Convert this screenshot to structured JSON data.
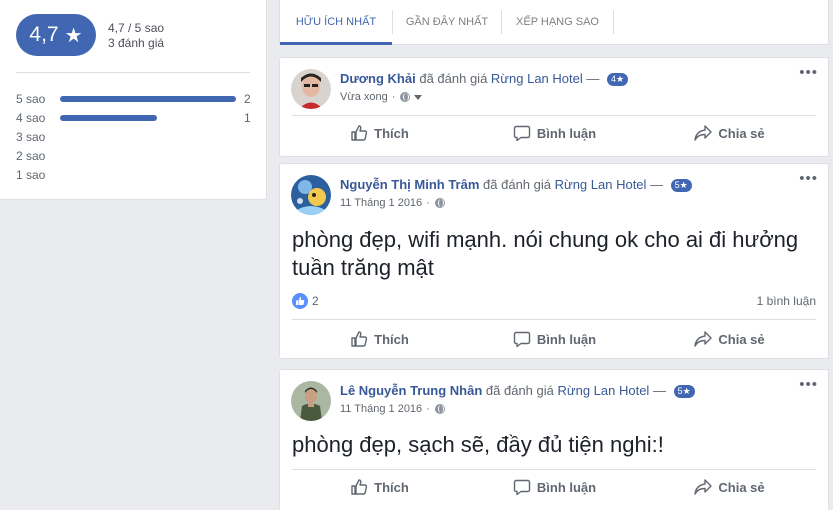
{
  "summary": {
    "score": "4,7",
    "star": "★",
    "score_text": "4,7 / 5 sao",
    "review_count": "3 đánh giá",
    "bars": [
      {
        "label": "5 sao",
        "fraction": 1.0,
        "count": "2"
      },
      {
        "label": "4 sao",
        "fraction": 0.55,
        "count": "1"
      },
      {
        "label": "3 sao",
        "fraction": 0,
        "count": ""
      },
      {
        "label": "2 sao",
        "fraction": 0,
        "count": ""
      },
      {
        "label": "1 sao",
        "fraction": 0,
        "count": ""
      }
    ],
    "accent": "#4267b2"
  },
  "tabs": [
    {
      "label": "HỮU ÍCH NHẤT",
      "active": true
    },
    {
      "label": "GẦN ĐÂY NHẤT",
      "active": false
    },
    {
      "label": "XẾP HẠNG SAO",
      "active": false
    }
  ],
  "reviews": [
    {
      "author": "Dương Khải",
      "verb": "đã đánh giá",
      "place": "Rừng Lan Hotel",
      "dash": "—",
      "rating": "4★",
      "time": "Vừa xong",
      "separator": "·",
      "text": "",
      "likes": "",
      "comments": "",
      "more": "•••"
    },
    {
      "author": "Nguyễn Thị Minh Trâm",
      "verb": "đã đánh giá",
      "place": "Rừng Lan Hotel",
      "dash": "—",
      "rating": "5★",
      "time": "11 Tháng 1 2016",
      "separator": "·",
      "text": "phòng đẹp, wifi mạnh. nói chung ok cho ai đi hưởng tuần trăng mật",
      "likes": "2",
      "comments": "1 bình luận",
      "more": "•••"
    },
    {
      "author": "Lê Nguyễn Trung Nhân",
      "verb": "đã đánh giá",
      "place": "Rừng Lan Hotel",
      "dash": "—",
      "rating": "5★",
      "time": "11 Tháng 1 2016",
      "separator": "·",
      "text": "phòng đẹp, sạch sẽ, đầy đủ tiện nghi:!",
      "likes": "",
      "comments": "",
      "more": "•••"
    }
  ],
  "actions": {
    "like": "Thích",
    "comment": "Bình luận",
    "share": "Chia sẻ"
  }
}
